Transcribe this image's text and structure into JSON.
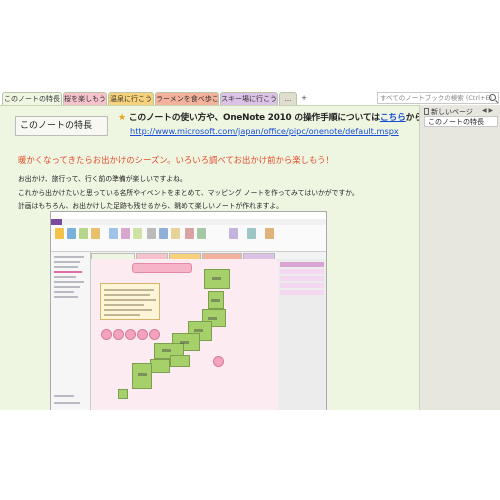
{
  "tabs": [
    {
      "label": "このノートの特長",
      "color": "#eef6e2"
    },
    {
      "label": "桜を楽しもう",
      "color": "#f6c3cc"
    },
    {
      "label": "温泉に行こう",
      "color": "#f8d27a"
    },
    {
      "label": "ラーメンを食べ歩こう",
      "color": "#f4b19b"
    },
    {
      "label": "スキー場に行こう",
      "color": "#dcc2e6"
    },
    {
      "label": "...",
      "color": "#e0dcd0"
    },
    {
      "label": "+",
      "color": "#ffffff"
    }
  ],
  "search": {
    "placeholder": "すべてのノートブックの検索 (Ctrl+E)"
  },
  "page": {
    "title": "このノートの特長",
    "headline_prefix": "このノートの使い方や、OneNote 2010 の操作手順については",
    "headline_link": "こちら",
    "headline_suffix": "から",
    "url": "http://www.microsoft.com/japan/office/pipc/onenote/default.mspx",
    "intro": "暖かくなってきたらお出かけのシーズン。いろいろ調べてお出かけ前から楽しもう！",
    "lines": [
      "お出かけ、旅行って、行く前の準備が楽しいですよね。",
      "これから出かけたいと思っている名所やイベントをまとめて、マッピング ノートを作ってみてはいかがですか。",
      "計画はもちろん、お出かけした足跡も残せるから、眺めて楽しいノートが作れますよ。"
    ]
  },
  "right_panel": {
    "new_page": "新しいページ",
    "arrows": "◀ ▶",
    "pages": [
      "このノートの特長"
    ]
  },
  "colors": {
    "page_bg": "#eef6e2",
    "link": "#1a4dd6",
    "intro": "#e24b2b",
    "onenote_purple": "#7a4aa0"
  }
}
